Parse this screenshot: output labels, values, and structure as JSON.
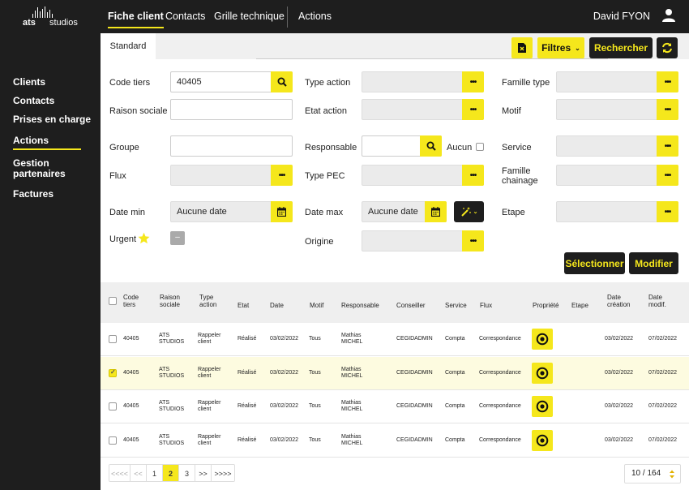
{
  "brand": {
    "logo_bold": "ats",
    "logo_rest": "studios"
  },
  "topnav": {
    "items": [
      "Fiche client",
      "Contacts",
      "Grille technique",
      "Actions"
    ],
    "user": "David FYON"
  },
  "sidebar": {
    "items": [
      "Clients",
      "Contacts",
      "Prises en charge",
      "Actions",
      "Gestion partenaires",
      "Factures"
    ],
    "active": "Actions"
  },
  "tabs": {
    "standard": "Standard"
  },
  "toolbar": {
    "filters": "Filtres",
    "search": "Rechercher"
  },
  "form": {
    "code_tiers": {
      "label": "Code tiers",
      "value": "40405"
    },
    "raison_sociale": {
      "label": "Raison sociale",
      "value": ""
    },
    "groupe": {
      "label": "Groupe",
      "value": ""
    },
    "flux": {
      "label": "Flux",
      "value": ""
    },
    "date_min": {
      "label": "Date min",
      "value": "Aucune date"
    },
    "urgent": {
      "label": "Urgent",
      "toggle": "–"
    },
    "type_action": {
      "label": "Type action",
      "value": ""
    },
    "etat_action": {
      "label": "Etat action",
      "value": ""
    },
    "responsable": {
      "label": "Responsable",
      "value": "",
      "none_label": "Aucun"
    },
    "type_pec": {
      "label": "Type PEC",
      "value": ""
    },
    "date_max": {
      "label": "Date max",
      "value": "Aucune date"
    },
    "origine": {
      "label": "Origine",
      "value": ""
    },
    "famille_type": {
      "label": "Famille type",
      "value": ""
    },
    "motif": {
      "label": "Motif",
      "value": ""
    },
    "service": {
      "label": "Service",
      "value": ""
    },
    "famille_chainage": {
      "label": "Famille chainage",
      "value": ""
    },
    "etape": {
      "label": "Etape",
      "value": ""
    }
  },
  "actions": {
    "select": "Sélectionner",
    "modify": "Modifier"
  },
  "table": {
    "columns": [
      "Code tiers",
      "Raison sociale",
      "Type action",
      "Etat",
      "Date",
      "Motif",
      "Responsable",
      "Conseiller",
      "Service",
      "Flux",
      "Propriété",
      "Etape",
      "Date création",
      "Date modif."
    ],
    "rows": [
      {
        "code": "40405",
        "raison": "ATS STUDIOS",
        "type": "Rappeler client",
        "etat": "Réalisé",
        "date": "03/02/2022",
        "motif": "Tous",
        "responsable": "Mathias MICHEL",
        "conseiller": "CEGIDADMIN",
        "service": "Compta",
        "flux": "Correspondance",
        "etape": "",
        "creation": "03/02/2022",
        "modif": "07/02/2022",
        "checked": false
      },
      {
        "code": "40405",
        "raison": "ATS STUDIOS",
        "type": "Rappeler client",
        "etat": "Réalisé",
        "date": "03/02/2022",
        "motif": "Tous",
        "responsable": "Mathias MICHEL",
        "conseiller": "CEGIDADMIN",
        "service": "Compta",
        "flux": "Correspondance",
        "etape": "",
        "creation": "03/02/2022",
        "modif": "07/02/2022",
        "checked": true
      },
      {
        "code": "40405",
        "raison": "ATS STUDIOS",
        "type": "Rappeler client",
        "etat": "Réalisé",
        "date": "03/02/2022",
        "motif": "Tous",
        "responsable": "Mathias MICHEL",
        "conseiller": "CEGIDADMIN",
        "service": "Compta",
        "flux": "Correspondance",
        "etape": "",
        "creation": "03/02/2022",
        "modif": "07/02/2022",
        "checked": false
      },
      {
        "code": "40405",
        "raison": "ATS STUDIOS",
        "type": "Rappeler client",
        "etat": "Réalisé",
        "date": "03/02/2022",
        "motif": "Tous",
        "responsable": "Mathias MICHEL",
        "conseiller": "CEGIDADMIN",
        "service": "Compta",
        "flux": "Correspondance",
        "etape": "",
        "creation": "03/02/2022",
        "modif": "07/02/2022",
        "checked": false
      }
    ]
  },
  "pagination": {
    "first": "<<<<",
    "prev": "<<",
    "pages": [
      "1",
      "2",
      "3"
    ],
    "current": "2",
    "next": ">>",
    "last": ">>>>",
    "page_size": "10 / 164"
  },
  "colors": {
    "accent": "#f5e71c",
    "dark": "#1e1e1e"
  }
}
